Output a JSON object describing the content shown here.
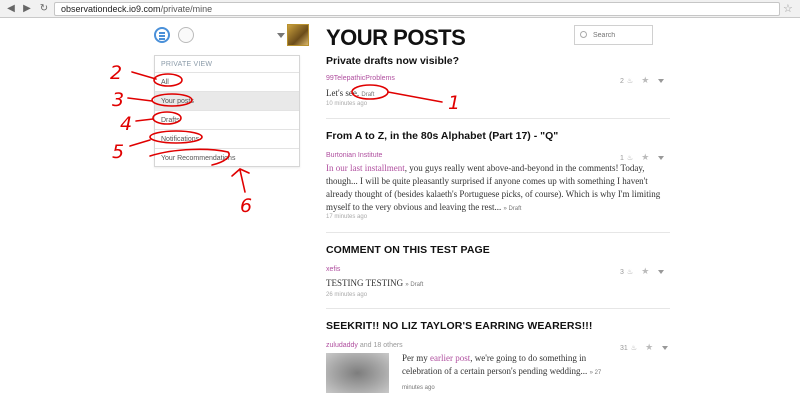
{
  "browser": {
    "url_host": "observationdeck.io9.com",
    "url_path": "/private/mine"
  },
  "sidebar": {
    "heading": "PRIVATE VIEW",
    "items": [
      {
        "label": "All"
      },
      {
        "label": "Your posts"
      },
      {
        "label": "Drafts"
      },
      {
        "label": "Notifications"
      },
      {
        "label": "Your Recommendations"
      }
    ]
  },
  "annotations": [
    "1",
    "2",
    "3",
    "4",
    "5",
    "6"
  ],
  "main": {
    "title": "YOUR POSTS",
    "search_placeholder": "Search",
    "posts": [
      {
        "title": "Private drafts now visible?",
        "author": "99TelepathicProblems",
        "body": "Let's see.",
        "draft": "Draft",
        "time": "10 minutes ago",
        "count": "2"
      },
      {
        "title": "From A to Z, in the 80s Alphabet (Part 17) - \"Q\"",
        "author": "Burtonian Institute",
        "body_link": "In our last installment",
        "body_rest": ", you guys really went above-and-beyond in the comments! Today, though... I will be quite pleasantly surprised if anyone comes up with something I haven't already thought of (besides kalaeth's Portuguese picks, of course). Which is why I'm limiting myself to the very obvious and leaving the rest...",
        "draft": "» Draft",
        "time": "17 minutes ago",
        "count": "1"
      },
      {
        "title": "COMMENT ON THIS TEST PAGE",
        "author": "xefis",
        "body": "TESTING TESTING",
        "draft": "» Draft",
        "time": "26 minutes ago",
        "count": "3"
      },
      {
        "title": "SEEKRIT!! NO LIZ TAYLOR'S EARRING WEARERS!!!",
        "author": "zuludaddy",
        "author_extra": "and 18 others",
        "body_pre": "Per my ",
        "body_link": "earlier post",
        "body_rest": ", we're going to do something in celebration of a certain person's pending wedding...",
        "draft": "» 27 minutes ago",
        "count": "31"
      }
    ]
  }
}
